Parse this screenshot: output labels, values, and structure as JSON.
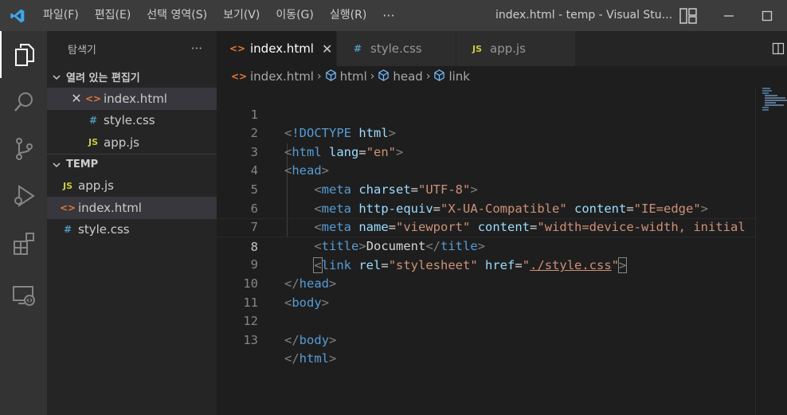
{
  "menu": {
    "items": [
      "파일(F)",
      "편집(E)",
      "선택 영역(S)",
      "보기(V)",
      "이동(G)",
      "실행(R)"
    ],
    "more": "···"
  },
  "window_title": "index.html - temp - Visual Stu...",
  "sidebar": {
    "title": "탐색기",
    "more": "···",
    "open_editors": {
      "label": "열려 있는 편집기",
      "files": [
        {
          "icon": "<>",
          "name": "index.html"
        },
        {
          "icon": "#",
          "name": "style.css"
        },
        {
          "icon": "JS",
          "name": "app.js"
        }
      ]
    },
    "folder": {
      "label": "TEMP",
      "files": [
        {
          "icon": "JS",
          "name": "app.js"
        },
        {
          "icon": "<>",
          "name": "index.html"
        },
        {
          "icon": "#",
          "name": "style.css"
        }
      ]
    }
  },
  "tabs": [
    {
      "icon": "<>",
      "label": "index.html"
    },
    {
      "icon": "#",
      "label": "style.css"
    },
    {
      "icon": "JS",
      "label": "app.js"
    }
  ],
  "breadcrumb": [
    "index.html",
    "html",
    "head",
    "link"
  ],
  "editor": {
    "line_numbers": [
      "1",
      "2",
      "3",
      "4",
      "5",
      "6",
      "7",
      "8",
      "9",
      "10",
      "11",
      "12",
      "13"
    ],
    "current_line": "8"
  },
  "colors": {
    "tag": "#569cd6",
    "attribute": "#9cdcfe",
    "string": "#ce9178",
    "punctuation": "#808080",
    "text": "#d4d4d4",
    "titlebar": "#3c3c3c",
    "activitybar": "#333333",
    "sidebar": "#252526",
    "editor": "#1e1e1e"
  },
  "icons": {
    "activity": [
      "explorer-icon",
      "search-icon",
      "source-control-icon",
      "run-debug-icon",
      "extensions-icon",
      "remote-explorer-icon"
    ],
    "window": [
      "layout-icon",
      "minimize-icon",
      "maximize-icon"
    ]
  }
}
